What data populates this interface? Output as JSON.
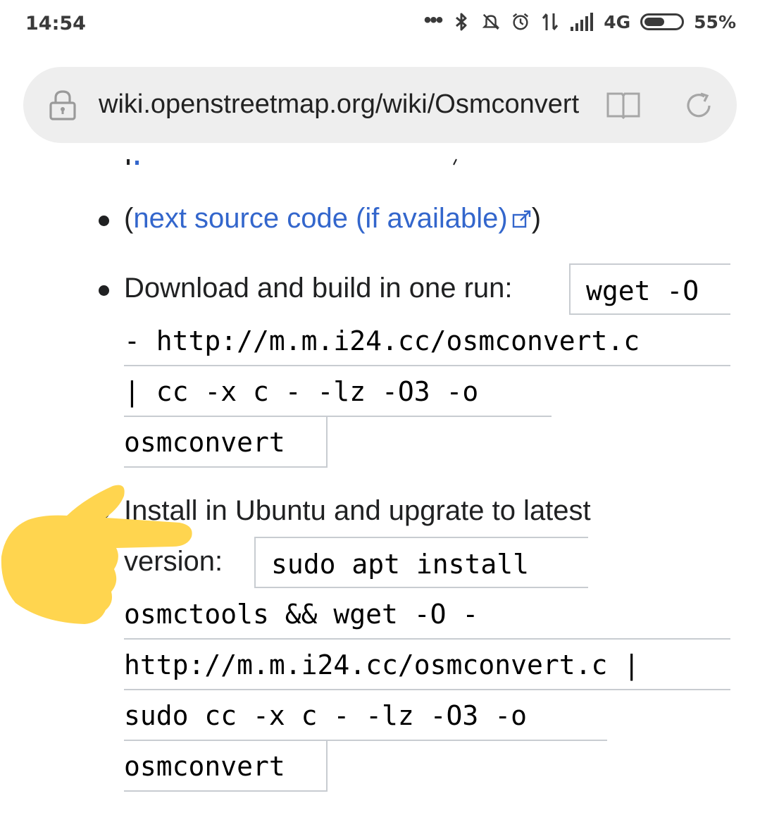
{
  "status_bar": {
    "time": "14:54",
    "dots": "•••",
    "network": "4G",
    "battery_percent": "55%",
    "battery_level": 0.55,
    "icons": [
      "bluetooth-icon",
      "mute-icon",
      "alarm-icon",
      "data-transfer-icon",
      "signal-icon",
      "battery-icon"
    ]
  },
  "address_bar": {
    "url": "wiki.openstreetmap.org/wiki/Osmconvert",
    "icons": [
      "lock-icon",
      "reader-mode-icon",
      "reload-icon"
    ]
  },
  "content": {
    "item1": {
      "open": "(",
      "link": "next source code (if available)",
      "close": ")"
    },
    "item2": {
      "label": "Download and build in one run:",
      "code_lines": [
        "wget -O",
        "- http://m.m.i24.cc/osmconvert.c",
        "| cc -x c - -lz -O3 -o",
        "osmconvert"
      ]
    },
    "item3": {
      "label_line1": "Install in Ubuntu and upgrate to latest",
      "label_line2": "version:",
      "code_lines": [
        "sudo apt install",
        "osmctools && wget -O -",
        "http://m.m.i24.cc/osmconvert.c |",
        "sudo cc -x c - -lz -O3 -o",
        "osmconvert"
      ]
    },
    "colors": {
      "link": "#3366cc",
      "highlight": "#ffd54f"
    }
  }
}
